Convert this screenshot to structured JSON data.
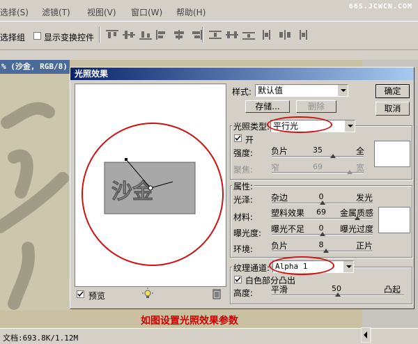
{
  "menubar": {
    "items": [
      "选择(S)",
      "滤镜(T)",
      "视图(V)",
      "窗口(W)",
      "帮助(H)"
    ],
    "watermark": "66S.JCWCN.COM"
  },
  "options": {
    "select_group": "选择组",
    "show_transform": "显示变换控件"
  },
  "document": {
    "title": "% (沙金, RGB/8)",
    "status": "文档:693.8K/1.12M"
  },
  "dialog": {
    "title": "光照效果",
    "style_label": "样式:",
    "style_value": "默认值",
    "save_button": "存储...",
    "delete_button": "删除",
    "ok_button": "确定",
    "cancel_button": "取消",
    "light_type_label": "光照类型:",
    "light_type_value": "平行光",
    "on_label": "开",
    "intensity_label": "强度:",
    "intensity_min": "负片",
    "intensity_max": "全",
    "intensity_value": "35",
    "focus_label": "聚焦:",
    "focus_min": "窄",
    "focus_max": "宽",
    "focus_value": "69",
    "properties_label": "属性:",
    "gloss_label": "光泽:",
    "gloss_min": "杂边",
    "gloss_max": "发光",
    "gloss_value": "0",
    "material_label": "材料:",
    "material_min": "塑料效果",
    "material_max": "金属质感",
    "material_value": "69",
    "exposure_label": "曝光度:",
    "exposure_min": "曝光不足",
    "exposure_max": "曝光过度",
    "exposure_value": "0",
    "ambience_label": "环境:",
    "ambience_min": "负片",
    "ambience_max": "正片",
    "ambience_value": "8",
    "texture_label": "纹理通道:",
    "texture_value": "Alpha 1",
    "white_high_label": "白色部分凸出",
    "height_label": "高度:",
    "height_min": "平滑",
    "height_max": "凸起",
    "height_value": "50",
    "preview_label": "预览",
    "preview_text": "沙金"
  },
  "caption": "如图设置光照效果参数",
  "colors": {
    "title_start": "#0a246a",
    "title_end": "#a6caf0",
    "highlight": "#d01010"
  },
  "levels": {
    "intensity": 0.67,
    "focus": 0.85,
    "gloss": 0.5,
    "material": 0.85,
    "exposure": 0.5,
    "ambience": 0.54,
    "height": 0.5
  }
}
